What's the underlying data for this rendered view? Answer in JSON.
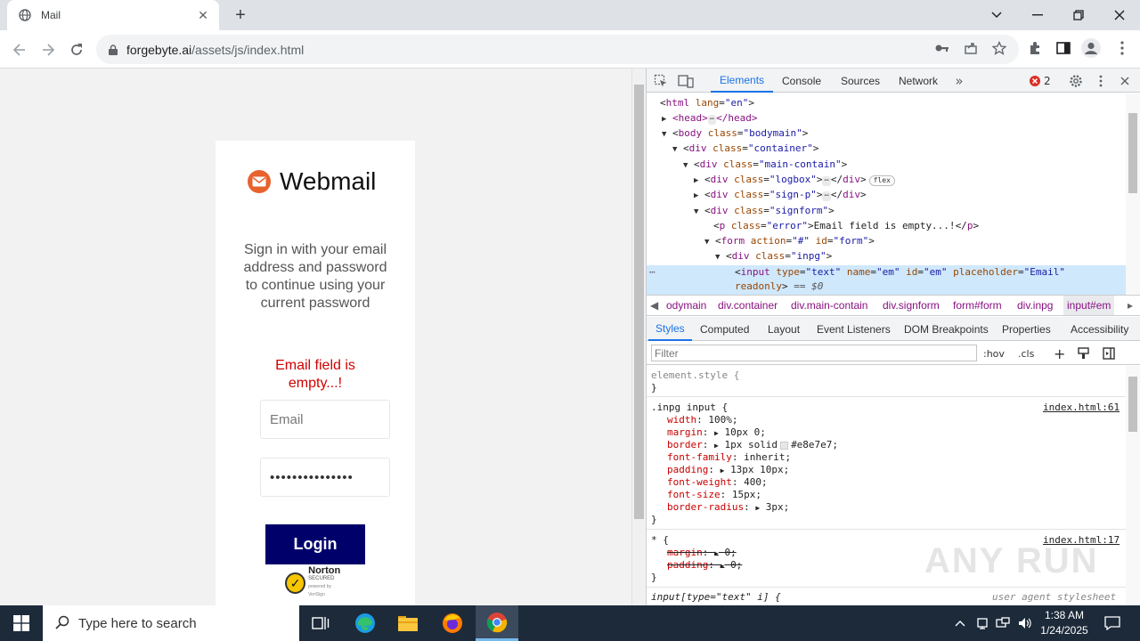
{
  "browser": {
    "tab": {
      "title": "Mail"
    },
    "url": {
      "host": "forgebyte.ai",
      "path": "/assets/js/index.html"
    }
  },
  "page": {
    "brand": "Webmail",
    "signin_text": "Sign in with your email address and password to continue using your current password",
    "error_text": "Email field is empty...!",
    "email": {
      "placeholder": "Email",
      "value": ""
    },
    "password": {
      "value": "•••••••••••••••"
    },
    "login_label": "Login",
    "norton": {
      "line1": "Norton",
      "line2": "SECURED",
      "line3": "powered by VeriSign"
    }
  },
  "devtools": {
    "tabs": {
      "elements": "Elements",
      "console": "Console",
      "sources": "Sources",
      "network": "Network"
    },
    "error_count": "2",
    "dom": {
      "html": {
        "tag": "html",
        "attr": "lang",
        "val": "\"en\""
      },
      "head": {
        "open": "<head>",
        "close": "</head>"
      },
      "body": {
        "tag": "body",
        "attr": "class",
        "val": "\"bodymain\""
      },
      "container": {
        "tag": "div",
        "attr": "class",
        "val": "\"container\""
      },
      "main_contain": {
        "tag": "div",
        "attr": "class",
        "val": "\"main-contain\""
      },
      "logbox": {
        "tag": "div",
        "attr": "class",
        "val": "\"logbox\"",
        "badge": "flex"
      },
      "sign_p": {
        "tag": "div",
        "attr": "class",
        "val": "\"sign-p\""
      },
      "signform": {
        "tag": "div",
        "attr": "class",
        "val": "\"signform\""
      },
      "error_p": {
        "tag": "p",
        "attr": "class",
        "val": "\"error\"",
        "text": "Email field is empty...!"
      },
      "form": {
        "tag": "form",
        "attr1": "action",
        "val1": "\"#\"",
        "attr2": "id",
        "val2": "\"form\""
      },
      "inpg": {
        "tag": "div",
        "attr": "class",
        "val": "\"inpg\""
      },
      "input": {
        "tag": "input",
        "a1": "type",
        "v1": "\"text\"",
        "a2": "name",
        "v2": "\"em\"",
        "a3": "id",
        "v3": "\"em\"",
        "a4": "placeholder",
        "v4": "\"Email\"",
        "a5": "readonly",
        "eq": " == $0"
      }
    },
    "breadcrumbs": [
      "odymain",
      "div.container",
      "div.main-contain",
      "div.signform",
      "form#form",
      "div.inpg",
      "input#em"
    ],
    "style_tabs": [
      "Styles",
      "Computed",
      "Layout",
      "Event Listeners",
      "DOM Breakpoints",
      "Properties",
      "Accessibility"
    ],
    "filter_placeholder": "Filter",
    "hov": ":hov",
    "cls": ".cls",
    "styles": {
      "element_style": "element.style {",
      "rule1": {
        "selector": ".inpg input {",
        "source": "index.html:61",
        "props": [
          {
            "name": "width",
            "value": "100%;"
          },
          {
            "name": "margin",
            "value": "10px 0;"
          },
          {
            "name": "border",
            "value": "1px solid",
            "color": "#e8e7e7;"
          },
          {
            "name": "font-family",
            "value": "inherit;"
          },
          {
            "name": "padding",
            "value": "13px 10px;"
          },
          {
            "name": "font-weight",
            "value": "400;"
          },
          {
            "name": "font-size",
            "value": "15px;"
          },
          {
            "name": "border-radius",
            "value": "3px;"
          }
        ]
      },
      "rule2": {
        "selector": "* {",
        "source": "index.html:17",
        "props": [
          {
            "name": "margin",
            "value": "0;"
          },
          {
            "name": "padding",
            "value": "0;"
          }
        ]
      },
      "rule3": {
        "selector": "input[type=\"text\" i] {",
        "source": "user agent stylesheet"
      },
      "close": "}"
    }
  },
  "watermark": "ANY RUN",
  "taskbar": {
    "search_placeholder": "Type here to search",
    "time": "1:38 AM",
    "date": "1/24/2025"
  }
}
